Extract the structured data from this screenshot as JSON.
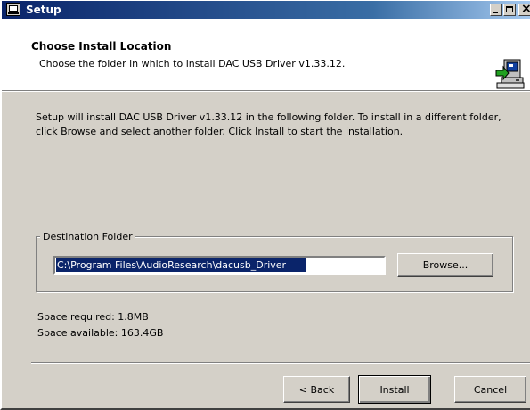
{
  "window": {
    "title": "Setup"
  },
  "header": {
    "title": "Choose Install Location",
    "subtitle": "Choose the folder in which to install DAC USB Driver v1.33.12."
  },
  "body": {
    "description": "Setup will install DAC USB Driver v1.33.12 in the following folder. To install in a different folder, click Browse and select another folder. Click Install to start the installation.",
    "destination_label": "Destination Folder",
    "destination_path": "C:\\Program Files\\AudioResearch\\dacusb_Driver",
    "browse_label": "Browse...",
    "space_required": "Space required: 1.8MB",
    "space_available": "Space available: 163.4GB"
  },
  "footer": {
    "back_label": "< Back",
    "install_label": "Install",
    "cancel_label": "Cancel"
  },
  "icons": {
    "app": "setup-app-icon",
    "header": "installer-computer-icon",
    "minimize": "minimize-icon",
    "maximize": "maximize-icon",
    "close": "close-icon"
  },
  "colors": {
    "title_bar": "#0a246a",
    "dialog_face": "#d4d0c8",
    "header_background": "#ffffff",
    "selection": "#0a246a"
  }
}
